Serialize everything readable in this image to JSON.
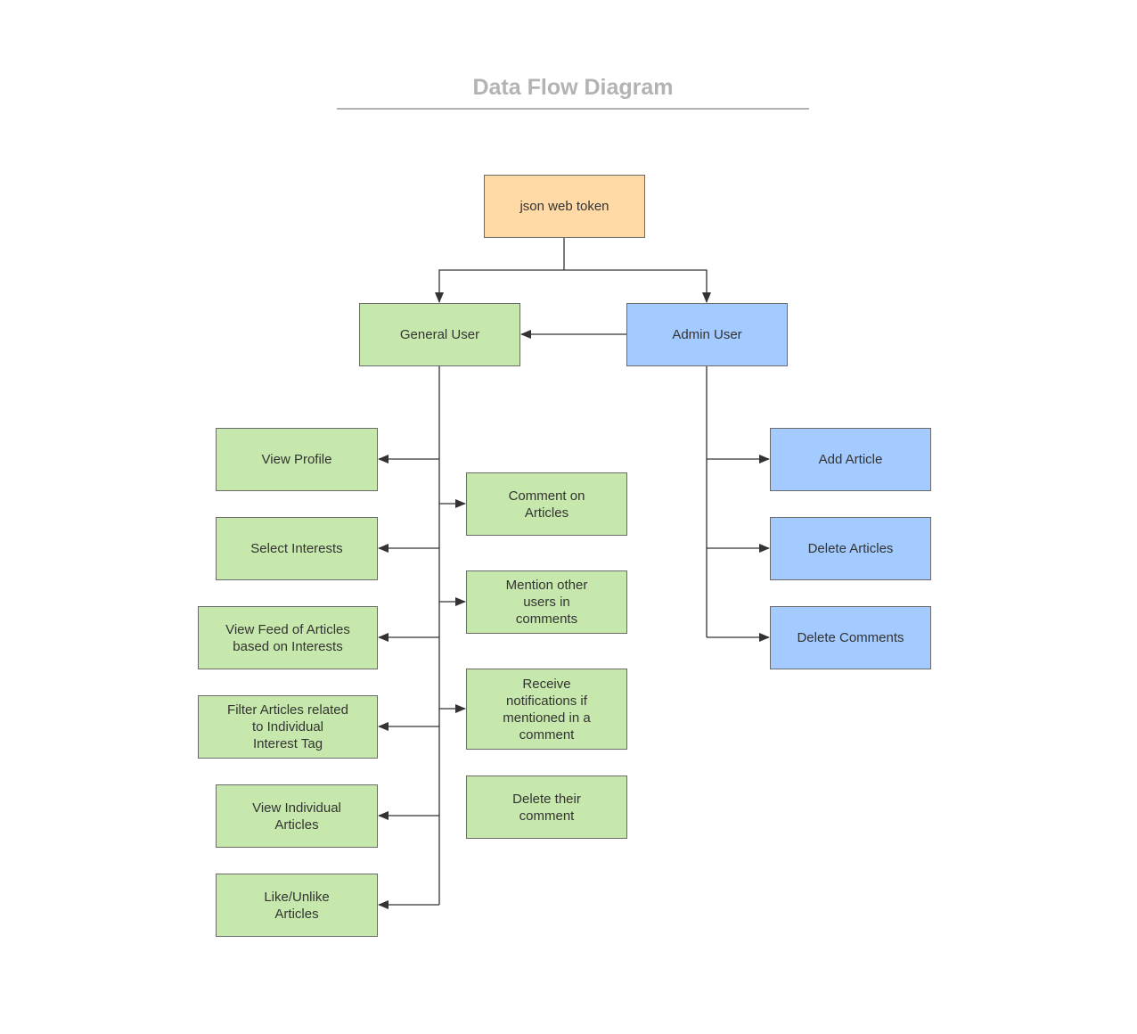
{
  "title": "Data Flow Diagram",
  "colors": {
    "token": "#ffd9a6",
    "general": "#c7e8ac",
    "admin": "#a3cbff",
    "border": "#6b6b6b",
    "line": "#333333",
    "title": "#b3b3b3"
  },
  "nodes": {
    "token": "json web token",
    "general_user": "General User",
    "admin_user": "Admin User",
    "view_profile": "View Profile",
    "select_interests": "Select Interests",
    "view_feed": "View Feed of Articles\nbased on Interests",
    "filter_articles": "Filter Articles related\nto Individual\nInterest Tag",
    "view_individual": "View Individual\nArticles",
    "like_unlike": "Like/Unlike\nArticles",
    "comment_on": "Comment on\nArticles",
    "mention_users": "Mention other\nusers in\ncomments",
    "receive_notifications": "Receive\nnotifications if\nmentioned in a\ncomment",
    "delete_their_comment": "Delete their\ncomment",
    "add_article": "Add Article",
    "delete_articles": "Delete Articles",
    "delete_comments": "Delete Comments"
  },
  "edges": [
    {
      "from": "token",
      "to": "general_user"
    },
    {
      "from": "token",
      "to": "admin_user"
    },
    {
      "from": "admin_user",
      "to": "general_user"
    },
    {
      "from": "general_user",
      "to": "view_profile"
    },
    {
      "from": "general_user",
      "to": "select_interests"
    },
    {
      "from": "general_user",
      "to": "view_feed"
    },
    {
      "from": "general_user",
      "to": "filter_articles"
    },
    {
      "from": "general_user",
      "to": "view_individual"
    },
    {
      "from": "general_user",
      "to": "like_unlike"
    },
    {
      "from": "general_user",
      "to": "comment_on"
    },
    {
      "from": "general_user",
      "to": "mention_users"
    },
    {
      "from": "general_user",
      "to": "receive_notifications"
    },
    {
      "from": "admin_user",
      "to": "add_article"
    },
    {
      "from": "admin_user",
      "to": "delete_articles"
    },
    {
      "from": "admin_user",
      "to": "delete_comments"
    }
  ]
}
